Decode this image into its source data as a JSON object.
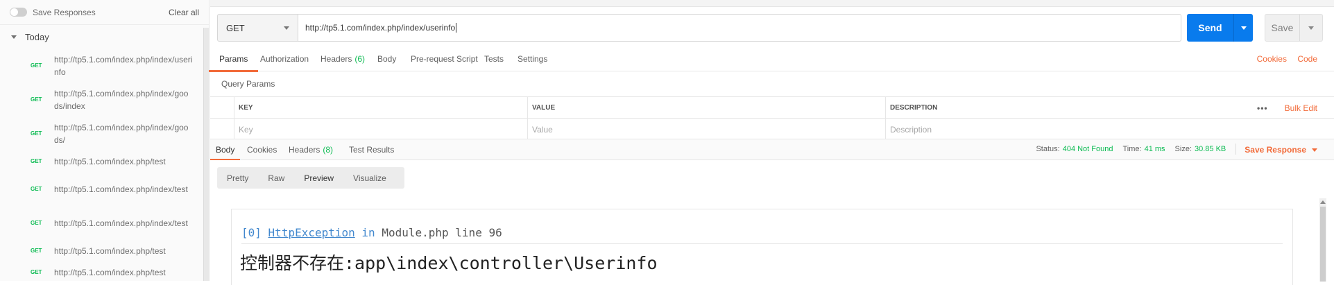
{
  "sidebar": {
    "save_responses_label": "Save Responses",
    "clear_all_label": "Clear all",
    "group_label": "Today",
    "items": [
      {
        "method": "GET",
        "url": "http://tp5.1.com/index.php/index/userinfo"
      },
      {
        "method": "GET",
        "url": "http://tp5.1.com/index.php/index/goods/index"
      },
      {
        "method": "GET",
        "url": "http://tp5.1.com/index.php/index/goods/"
      },
      {
        "method": "GET",
        "url": "http://tp5.1.com/index.php/test"
      },
      {
        "method": "GET",
        "url": "http://tp5.1.com/index.php/index/test"
      },
      {
        "method": "GET",
        "url": "http://tp5.1.com/index.php/index/test"
      },
      {
        "method": "GET",
        "url": "http://tp5.1.com/index.php/test"
      },
      {
        "method": "GET",
        "url": "http://tp5.1.com/index.php/test"
      }
    ]
  },
  "request": {
    "method": "GET",
    "url": "http://tp5.1.com/index.php/index/userinfo",
    "send_label": "Send",
    "save_label": "Save"
  },
  "request_tabs": {
    "params": "Params",
    "authorization": "Authorization",
    "headers": "Headers",
    "headers_count": "(6)",
    "body": "Body",
    "prerequest": "Pre-request Script",
    "tests": "Tests",
    "settings": "Settings",
    "cookies": "Cookies",
    "code": "Code"
  },
  "query_params": {
    "title": "Query Params",
    "col_key": "KEY",
    "col_value": "VALUE",
    "col_description": "DESCRIPTION",
    "bulk_edit": "Bulk Edit",
    "more": "•••",
    "placeholder_key": "Key",
    "placeholder_value": "Value",
    "placeholder_description": "Description"
  },
  "response_tabs": {
    "body": "Body",
    "cookies": "Cookies",
    "headers": "Headers",
    "headers_count": "(8)",
    "test_results": "Test Results"
  },
  "response_stats": {
    "status_label": "Status:",
    "status_value": "404 Not Found",
    "time_label": "Time:",
    "time_value": "41 ms",
    "size_label": "Size:",
    "size_value": "30.85 KB",
    "save_response": "Save Response"
  },
  "format_tabs": {
    "pretty": "Pretty",
    "raw": "Raw",
    "preview": "Preview",
    "visualize": "Visualize"
  },
  "response_body": {
    "index": "[0]",
    "exception_class": "HttpException",
    "in_word": "in",
    "file_line": "Module.php line 96",
    "message": "控制器不存在:app\\index\\controller\\Userinfo"
  },
  "colors": {
    "accent": "#f26b3a",
    "send_blue": "#097bed",
    "get_green": "#0cbb52"
  }
}
